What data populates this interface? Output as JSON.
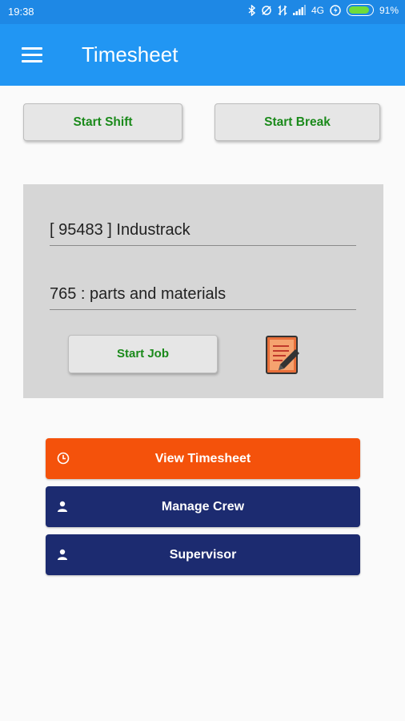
{
  "status_bar": {
    "time": "19:38",
    "network": "4G",
    "battery": "91%",
    "battery_level": 0.91
  },
  "app_bar": {
    "title": "Timesheet",
    "menu_icon": "hamburger-menu-icon"
  },
  "shift_controls": {
    "start_shift": "Start Shift",
    "start_break": "Start Break"
  },
  "job_panel": {
    "customer": "[ 95483 ] Industrack",
    "task": "765 : parts and materials",
    "start_job": "Start Job",
    "notes_icon": "notepad-edit-icon"
  },
  "actions": [
    {
      "label": "View Timesheet",
      "icon": "clock-icon",
      "color": "#f4520b"
    },
    {
      "label": "Manage Crew",
      "icon": "person-icon",
      "color": "#1c2b70"
    },
    {
      "label": "Supervisor",
      "icon": "person-icon",
      "color": "#1c2b70"
    }
  ],
  "colors": {
    "status_bar": "#1e88e5",
    "app_bar": "#2196f3",
    "button_text_green": "#1b8a1b",
    "panel_bg": "#d6d6d6"
  }
}
